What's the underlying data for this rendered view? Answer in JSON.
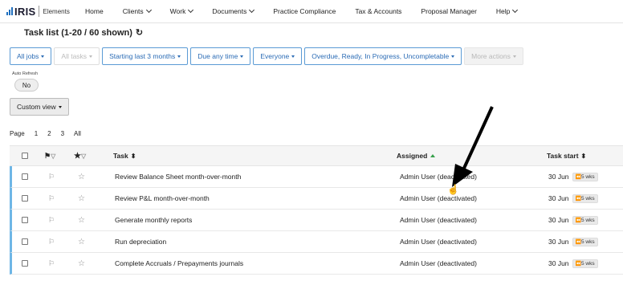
{
  "brand": {
    "name": "IRIS",
    "product": "Elements"
  },
  "nav": [
    {
      "label": "Home",
      "dropdown": false
    },
    {
      "label": "Clients",
      "dropdown": true
    },
    {
      "label": "Work",
      "dropdown": true
    },
    {
      "label": "Documents",
      "dropdown": true
    },
    {
      "label": "Practice Compliance",
      "dropdown": false
    },
    {
      "label": "Tax & Accounts",
      "dropdown": false
    },
    {
      "label": "Proposal Manager",
      "dropdown": false
    },
    {
      "label": "Help",
      "dropdown": true
    }
  ],
  "page_title": "Task list (1-20 / 60 shown)",
  "filters": [
    {
      "label": "All jobs",
      "state": "active"
    },
    {
      "label": "All tasks",
      "state": "disabled"
    },
    {
      "label": "Starting last 3 months",
      "state": "active"
    },
    {
      "label": "Due any time",
      "state": "active"
    },
    {
      "label": "Everyone",
      "state": "active"
    },
    {
      "label": "Overdue, Ready, In Progress, Uncompletable",
      "state": "active"
    },
    {
      "label": "More actions",
      "state": "grey"
    }
  ],
  "auto_refresh": {
    "label": "Auto Refresh",
    "value": "No"
  },
  "custom_view_label": "Custom view",
  "pager": {
    "label": "Page",
    "pages": [
      "1",
      "2",
      "3",
      "All"
    ]
  },
  "columns": {
    "task": "Task",
    "assigned": "Assigned",
    "task_start": "Task start"
  },
  "rows": [
    {
      "task": "Review Balance Sheet month-over-month",
      "assigned": "Admin User (deactivated)",
      "start": "30 Jun",
      "weeks": "5 wks"
    },
    {
      "task": "Review P&L month-over-month",
      "assigned": "Admin User (deactivated)",
      "start": "30 Jun",
      "weeks": "5 wks"
    },
    {
      "task": "Generate monthly reports",
      "assigned": "Admin User (deactivated)",
      "start": "30 Jun",
      "weeks": "5 wks"
    },
    {
      "task": "Run depreciation",
      "assigned": "Admin User (deactivated)",
      "start": "30 Jun",
      "weeks": "5 wks"
    },
    {
      "task": "Complete Accruals / Prepayments journals",
      "assigned": "Admin User (deactivated)",
      "start": "30 Jun",
      "weeks": "5 wks"
    }
  ],
  "colors": {
    "accent": "#2a6bb5",
    "row_marker": "#6eb6e6",
    "sort_active": "#37a04b"
  }
}
